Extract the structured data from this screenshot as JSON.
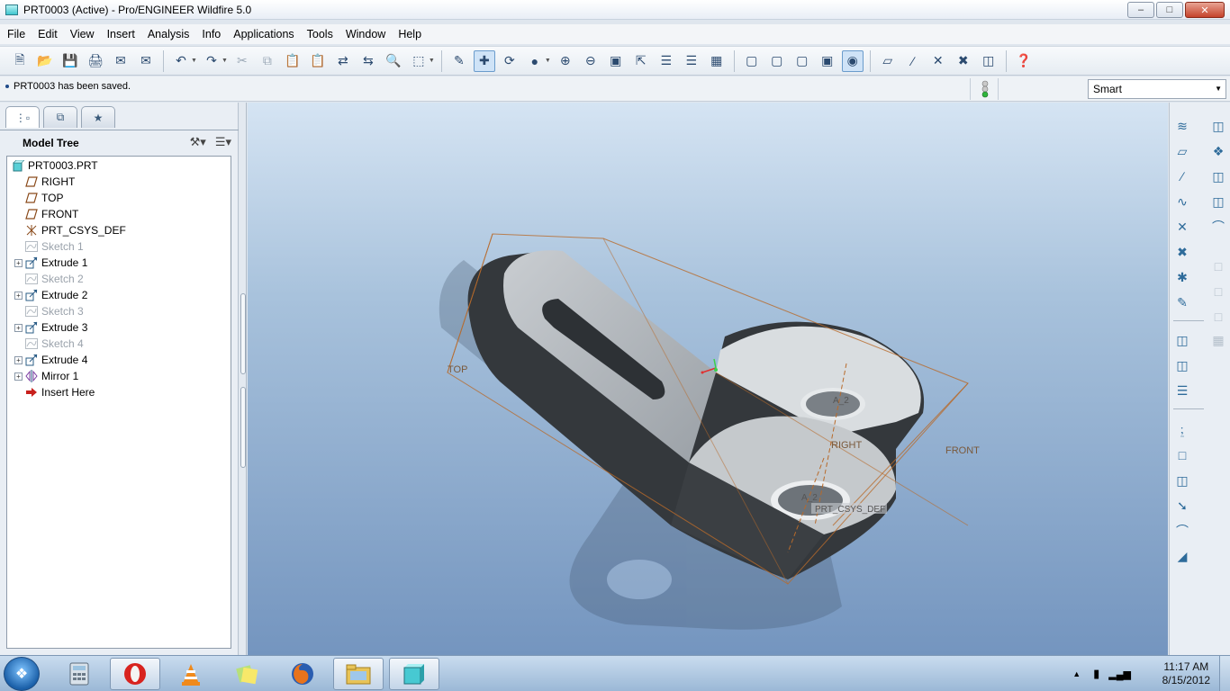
{
  "window": {
    "title": "PRT0003 (Active) - Pro/ENGINEER Wildfire 5.0",
    "minimize": "–",
    "restore": "□",
    "close": "✕"
  },
  "menu": [
    "File",
    "Edit",
    "View",
    "Insert",
    "Analysis",
    "Info",
    "Applications",
    "Tools",
    "Window",
    "Help"
  ],
  "message": {
    "text": "PRT0003 has been saved."
  },
  "filter": {
    "value": "Smart"
  },
  "model_tree": {
    "title": "Model Tree",
    "items": [
      {
        "label": "PRT0003.PRT",
        "icon": "part-icon",
        "expandable": false,
        "greyed": false
      },
      {
        "label": "RIGHT",
        "icon": "datum-plane-icon",
        "expandable": false,
        "greyed": false
      },
      {
        "label": "TOP",
        "icon": "datum-plane-icon",
        "expandable": false,
        "greyed": false
      },
      {
        "label": "FRONT",
        "icon": "datum-plane-icon",
        "expandable": false,
        "greyed": false
      },
      {
        "label": "PRT_CSYS_DEF",
        "icon": "csys-icon",
        "expandable": false,
        "greyed": false
      },
      {
        "label": "Sketch 1",
        "icon": "sketch-icon",
        "expandable": false,
        "greyed": true
      },
      {
        "label": "Extrude 1",
        "icon": "extrude-icon",
        "expandable": true,
        "greyed": false
      },
      {
        "label": "Sketch 2",
        "icon": "sketch-icon",
        "expandable": false,
        "greyed": true
      },
      {
        "label": "Extrude 2",
        "icon": "extrude-icon",
        "expandable": true,
        "greyed": false
      },
      {
        "label": "Sketch 3",
        "icon": "sketch-icon",
        "expandable": false,
        "greyed": true
      },
      {
        "label": "Extrude 3",
        "icon": "extrude-icon",
        "expandable": true,
        "greyed": false
      },
      {
        "label": "Sketch 4",
        "icon": "sketch-icon",
        "expandable": false,
        "greyed": true
      },
      {
        "label": "Extrude 4",
        "icon": "extrude-icon",
        "expandable": true,
        "greyed": false
      },
      {
        "label": "Mirror 1",
        "icon": "mirror-icon",
        "expandable": true,
        "greyed": false
      },
      {
        "label": "Insert Here",
        "icon": "insert-arrow-icon",
        "expandable": false,
        "greyed": false
      }
    ]
  },
  "viewport": {
    "labels": {
      "top": "TOP",
      "right": "RIGHT",
      "front": "FRONT",
      "csys": "PRT_CSYS_DEF",
      "axis1": "A_2",
      "axis2": "A_2"
    }
  },
  "taskbar": {
    "time": "11:17 AM",
    "date": "8/15/2012"
  },
  "colors": {
    "datum": "#b86a2a",
    "part_light": "#b8bcc0",
    "part_dark": "#34383c",
    "accent": "#1f4b8a"
  }
}
